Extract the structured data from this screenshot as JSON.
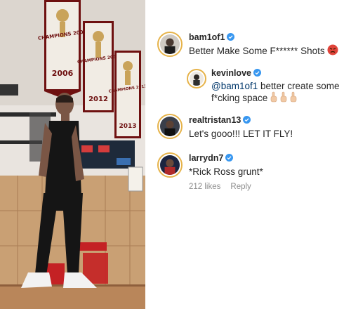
{
  "photo": {
    "banners": [
      "CHAMPIONS 2006",
      "CHAMPIONS 2012",
      "CHAMPIONS 2013"
    ]
  },
  "comments": [
    {
      "username": "bam1of1",
      "verified": true,
      "text": "Better Make Some F****** Shots",
      "emoji": "angry-face",
      "replies": [
        {
          "username": "kevinlove",
          "verified": true,
          "mention": "@bam1of1",
          "text": " better create some",
          "text_line2": "f*cking space",
          "emoji": "raised-finger x3"
        }
      ]
    },
    {
      "username": "realtristan13",
      "verified": true,
      "text": "Let's gooo!!! LET IT FLY!"
    },
    {
      "username": "larrydn7",
      "verified": true,
      "text": "*Rick Ross grunt*",
      "likes": "212 likes",
      "reply_label": "Reply"
    }
  ],
  "colors": {
    "verified": "#3897f0",
    "story_ring": "#e6b34a",
    "mention": "#00376b",
    "meta": "#8e8e8e"
  }
}
